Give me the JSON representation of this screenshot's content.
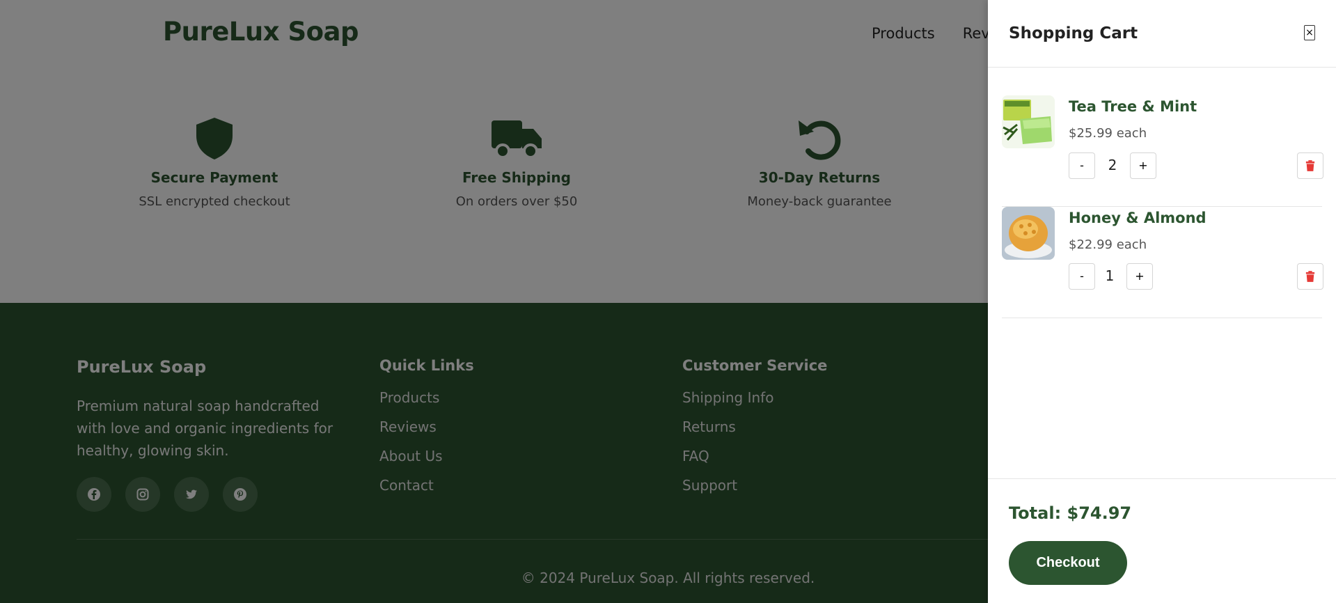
{
  "header": {
    "brand": "PureLux Soap",
    "nav": [
      "Products",
      "Reviews"
    ]
  },
  "features": [
    {
      "icon": "shield-icon",
      "title": "Secure Payment",
      "desc": "SSL encrypted checkout"
    },
    {
      "icon": "truck-icon",
      "title": "Free Shipping",
      "desc": "On orders over $50"
    },
    {
      "icon": "undo-icon",
      "title": "30-Day Returns",
      "desc": "Money-back guarantee"
    }
  ],
  "footer": {
    "brand": "PureLux Soap",
    "about": "Premium natural soap handcrafted with love and organic ingredients for healthy, glowing skin.",
    "quick_links": {
      "title": "Quick Links",
      "items": [
        "Products",
        "Reviews",
        "About Us",
        "Contact"
      ]
    },
    "customer_service": {
      "title": "Customer Service",
      "items": [
        "Shipping Info",
        "Returns",
        "FAQ",
        "Support"
      ]
    },
    "socials": [
      "facebook-icon",
      "instagram-icon",
      "twitter-icon",
      "pinterest-icon"
    ],
    "copyright": "© 2024 PureLux Soap. All rights reserved."
  },
  "cart": {
    "title": "Shopping Cart",
    "close_label": "×",
    "items": [
      {
        "name": "Tea Tree & Mint",
        "price": "$25.99 each",
        "qty": "2",
        "minus": "-",
        "plus": "+"
      },
      {
        "name": "Honey & Almond",
        "price": "$22.99 each",
        "qty": "1",
        "minus": "-",
        "plus": "+"
      }
    ],
    "total": "Total: $74.97",
    "checkout_label": "Checkout"
  },
  "colors": {
    "brand_green": "#2c5530",
    "delete_red": "#e53935"
  }
}
